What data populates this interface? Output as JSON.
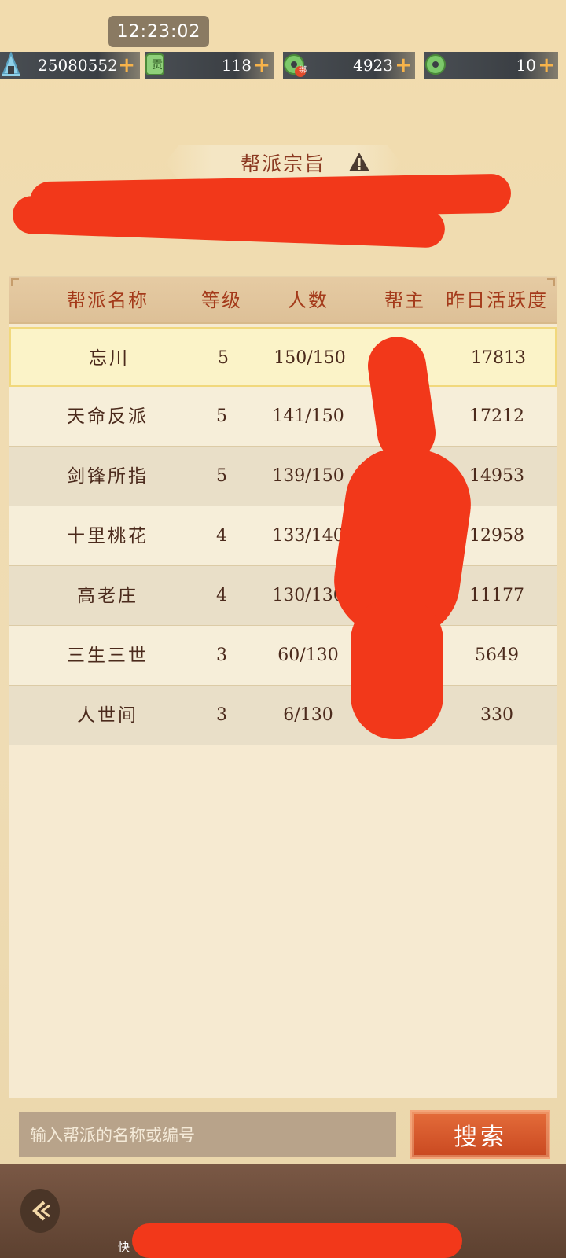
{
  "status": {
    "time": "12:23:02"
  },
  "resources": [
    {
      "icon": "silver-tower-icon",
      "value": "25080552"
    },
    {
      "icon": "contribution-token-icon",
      "value": "118",
      "badge": "贡"
    },
    {
      "icon": "bound-jade-icon",
      "value": "4923",
      "badge": "绑"
    },
    {
      "icon": "jade-icon",
      "value": "10"
    }
  ],
  "purpose": {
    "title": "帮派宗旨"
  },
  "table": {
    "headers": [
      "帮派名称",
      "等级",
      "人数",
      "帮主",
      "昨日活跃度"
    ],
    "rows": [
      {
        "name": "忘川",
        "level": "5",
        "members": "150/150",
        "activity": "17813"
      },
      {
        "name": "天命反派",
        "level": "5",
        "members": "141/150",
        "activity": "17212"
      },
      {
        "name": "剑锋所指",
        "level": "5",
        "members": "139/150",
        "activity": "14953"
      },
      {
        "name": "十里桃花",
        "level": "4",
        "members": "133/140",
        "activity": "12958"
      },
      {
        "name": "高老庄",
        "level": "4",
        "members": "130/130",
        "activity": "11177"
      },
      {
        "name": "三生三世",
        "level": "3",
        "members": "60/130",
        "activity": "5649"
      },
      {
        "name": "人世间",
        "level": "3",
        "members": "6/130",
        "activity": "330"
      }
    ]
  },
  "search": {
    "placeholder": "输入帮派的名称或编号",
    "button": "搜索"
  },
  "footer": {
    "text": "快"
  },
  "colors": {
    "accent": "#c94820",
    "redaction": "#f2381a"
  }
}
